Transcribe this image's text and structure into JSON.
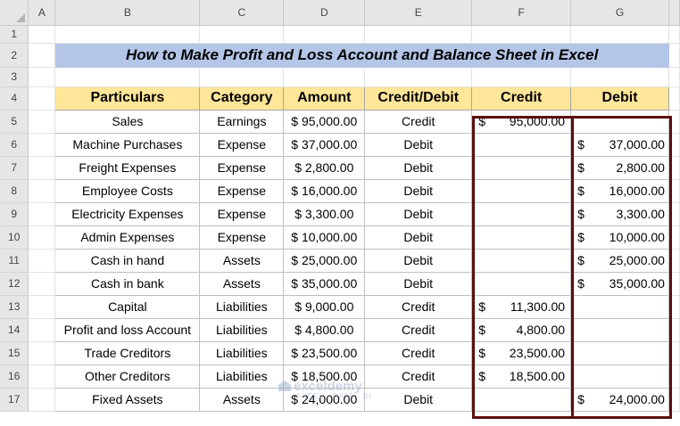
{
  "columns": [
    "",
    "A",
    "B",
    "C",
    "D",
    "E",
    "F",
    "G"
  ],
  "rows": [
    "1",
    "2",
    "3",
    "4",
    "5",
    "6",
    "7",
    "8",
    "9",
    "10",
    "11",
    "12",
    "13",
    "14",
    "15",
    "16",
    "17"
  ],
  "title": "How to Make Profit and Loss Account and Balance Sheet in Excel",
  "headers": {
    "particulars": "Particulars",
    "category": "Category",
    "amount": "Amount",
    "credit_debit": "Credit/Debit",
    "credit": "Credit",
    "debit": "Debit"
  },
  "currency_symbol": "$",
  "records": [
    {
      "particulars": "Sales",
      "category": "Earnings",
      "amount": "$ 95,000.00",
      "cd": "Credit",
      "credit": "95,000.00",
      "debit": ""
    },
    {
      "particulars": "Machine Purchases",
      "category": "Expense",
      "amount": "$ 37,000.00",
      "cd": "Debit",
      "credit": "",
      "debit": "37,000.00"
    },
    {
      "particulars": "Freight Expenses",
      "category": "Expense",
      "amount": "$  2,800.00",
      "cd": "Debit",
      "credit": "",
      "debit": "2,800.00"
    },
    {
      "particulars": "Employee Costs",
      "category": "Expense",
      "amount": "$ 16,000.00",
      "cd": "Debit",
      "credit": "",
      "debit": "16,000.00"
    },
    {
      "particulars": "Electricity Expenses",
      "category": "Expense",
      "amount": "$  3,300.00",
      "cd": "Debit",
      "credit": "",
      "debit": "3,300.00"
    },
    {
      "particulars": "Admin Expenses",
      "category": "Expense",
      "amount": "$ 10,000.00",
      "cd": "Debit",
      "credit": "",
      "debit": "10,000.00"
    },
    {
      "particulars": "Cash in hand",
      "category": "Assets",
      "amount": "$ 25,000.00",
      "cd": "Debit",
      "credit": "",
      "debit": "25,000.00"
    },
    {
      "particulars": "Cash in bank",
      "category": "Assets",
      "amount": "$ 35,000.00",
      "cd": "Debit",
      "credit": "",
      "debit": "35,000.00"
    },
    {
      "particulars": "Capital",
      "category": "Liabilities",
      "amount": "$  9,000.00",
      "cd": "Credit",
      "credit": "11,300.00",
      "debit": ""
    },
    {
      "particulars": "Profit and loss Account",
      "category": "Liabilities",
      "amount": "$  4,800.00",
      "cd": "Credit",
      "credit": "4,800.00",
      "debit": ""
    },
    {
      "particulars": "Trade Creditors",
      "category": "Liabilities",
      "amount": "$ 23,500.00",
      "cd": "Credit",
      "credit": "23,500.00",
      "debit": ""
    },
    {
      "particulars": "Other Creditors",
      "category": "Liabilities",
      "amount": "$ 18,500.00",
      "cd": "Credit",
      "credit": "18,500.00",
      "debit": ""
    },
    {
      "particulars": "Fixed Assets",
      "category": "Assets",
      "amount": "$ 24,000.00",
      "cd": "Debit",
      "credit": "",
      "debit": "24,000.00"
    }
  ],
  "watermark": {
    "brand": "exceldemy",
    "tagline": "EXCEL · DATA · BI"
  },
  "colors": {
    "title_bg": "#b4c6e7",
    "header_bg": "#ffe699",
    "selection_border": "#5b0f0f"
  }
}
